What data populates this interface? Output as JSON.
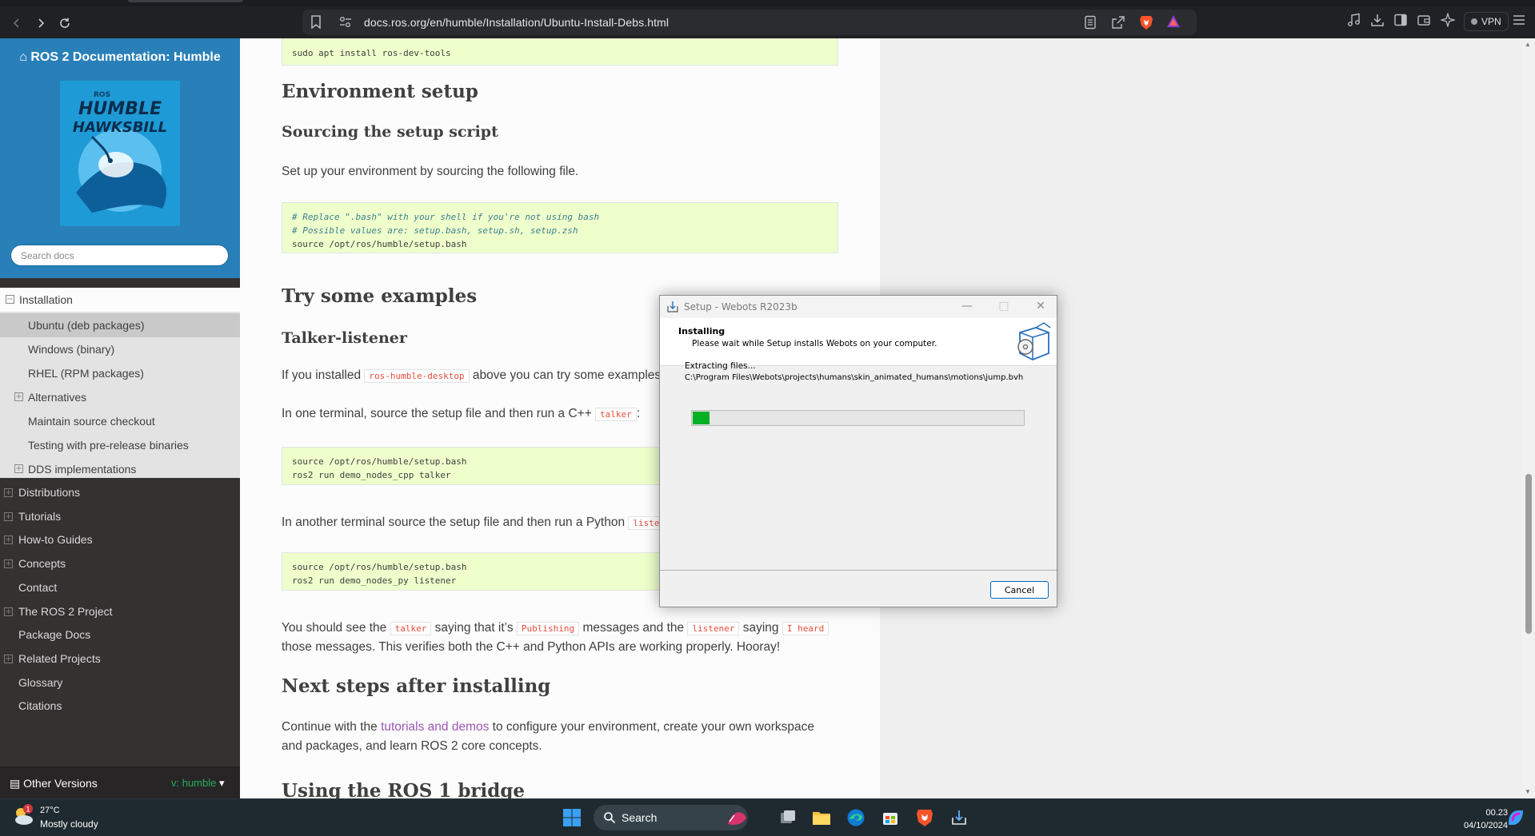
{
  "browser": {
    "url": "docs.ros.org/en/humble/Installation/Ubuntu-Install-Debs.html",
    "vpn_label": "VPN"
  },
  "sidebar": {
    "title": "ROS 2 Documentation: Humble",
    "logo_text_top": "ROS",
    "logo_text_1": "HUMBLE",
    "logo_text_2": "HAWKSBILL",
    "search_placeholder": "Search docs",
    "current": "Installation",
    "sub_items": [
      {
        "label": "Ubuntu (deb packages)",
        "expandable": false
      },
      {
        "label": "Windows (binary)",
        "expandable": false
      },
      {
        "label": "RHEL (RPM packages)",
        "expandable": false
      },
      {
        "label": "Alternatives",
        "expandable": true
      },
      {
        "label": "Maintain source checkout",
        "expandable": false
      },
      {
        "label": "Testing with pre-release binaries",
        "expandable": false
      },
      {
        "label": "DDS implementations",
        "expandable": true
      }
    ],
    "items": [
      {
        "label": "Distributions",
        "expandable": true
      },
      {
        "label": "Tutorials",
        "expandable": true
      },
      {
        "label": "How-to Guides",
        "expandable": true
      },
      {
        "label": "Concepts",
        "expandable": true
      },
      {
        "label": "Contact",
        "expandable": false
      },
      {
        "label": "The ROS 2 Project",
        "expandable": true
      },
      {
        "label": "Package Docs",
        "expandable": false
      },
      {
        "label": "Related Projects",
        "expandable": true
      },
      {
        "label": "Glossary",
        "expandable": false
      },
      {
        "label": "Citations",
        "expandable": false
      }
    ],
    "other_versions": "Other Versions",
    "version": "v: humble"
  },
  "content": {
    "code0": "sudo apt install ros-dev-tools",
    "h_env": "Environment setup",
    "h_sourcing": "Sourcing the setup script",
    "p_setup": "Set up your environment by sourcing the following file.",
    "code1_c1": "# Replace \".bash\" with your shell if you're not using bash",
    "code1_c2": "# Possible values are: setup.bash, setup.sh, setup.zsh",
    "code1_l3": "source /opt/ros/humble/setup.bash",
    "h_try": "Try some examples",
    "h_talker": "Talker-listener",
    "p_installed_a": "If you installed ",
    "p_installed_lit": "ros-humble-desktop",
    "p_installed_b": " above you can try some examples",
    "p_one_a": "In one terminal, source the setup file and then run a C++ ",
    "p_one_lit": "talker",
    "p_one_b": ":",
    "code2_l1": "source /opt/ros/humble/setup.bash",
    "code2_l2": "ros2 run demo_nodes_cpp talker",
    "p_another_a": "In another terminal source the setup file and then run a Python ",
    "p_another_lit": "listener",
    "code3_l1": "source /opt/ros/humble/setup.bash",
    "code3_l2": "ros2 run demo_nodes_py listener",
    "p_see_a": "You should see the ",
    "p_see_lit1": "talker",
    "p_see_b": " saying that it’s ",
    "p_see_lit2": "Publishing",
    "p_see_c": " messages and the ",
    "p_see_lit3": "listener",
    "p_see_d": " saying ",
    "p_see_lit4": "I heard",
    "p_see_line2": "those messages. This verifies both the C++ and Python APIs are working properly. Hooray!",
    "h_next": "Next steps after installing",
    "p_cont_a": "Continue with the ",
    "p_cont_link": "tutorials and demos",
    "p_cont_b": " to configure your environment, create your own workspace",
    "p_cont_line2": "and packages, and learn ROS 2 core concepts.",
    "h_bridge": "Using the ROS 1 bridge"
  },
  "dialog": {
    "title": "Setup - Webots R2023b",
    "heading": "Installing",
    "subheading": "Please wait while Setup installs Webots on your computer.",
    "status": "Extracting files...",
    "path": "C:\\Program Files\\Webots\\projects\\humans\\skin_animated_humans\\motions\\jump.bvh",
    "progress_fraction": 0.05,
    "cancel_label": "Cancel"
  },
  "taskbar": {
    "weather_badge": "1",
    "temperature": "27°C",
    "condition": "Mostly cloudy",
    "search_label": "Search",
    "time": "00.23",
    "date": "04/10/2024"
  },
  "colors": {
    "sidebar_blue": "#2980b9",
    "progress_green": "#06b025",
    "link_purple": "#9b59b6"
  }
}
